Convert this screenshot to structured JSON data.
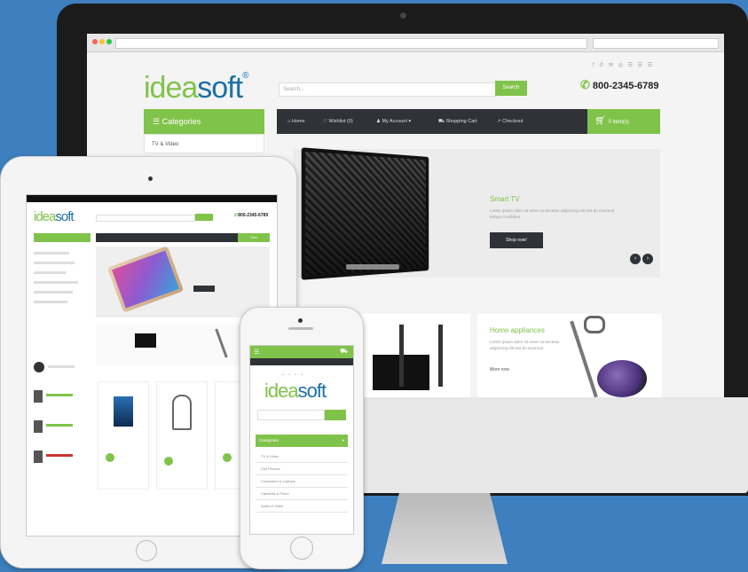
{
  "brand": {
    "idea": "idea",
    "soft": "soft",
    "reg": "®"
  },
  "desktop": {
    "search_placeholder": "Search...",
    "search_button": "Search",
    "phone": "800-2345-6789",
    "social": "f ✆ ✉ ◎  ☰ ☰ ☰",
    "categories_title": "Categories",
    "category_first": "TV & Video",
    "nav": [
      "Home",
      "Wishlist (0)",
      "My Account ▾",
      "Shopping Cart",
      "Checkout"
    ],
    "cart": "0 item(s)",
    "hero": {
      "title": "Smart TV",
      "text": "Lorem ipsum dolor sit amet consectetur adipiscing elit sed do eiusmod tempor incididunt",
      "button": "Shop now!"
    },
    "promo": {
      "title": "Home appliances",
      "text": "Lorem ipsum dolor sit amet consectetur adipiscing elit sed do eiusmod",
      "more": "More now"
    }
  },
  "tablet": {
    "cart_btn": "Cart",
    "phone": "800-2345-6789"
  },
  "mobile": {
    "categories_title": "Categories",
    "items": [
      "TV & Video",
      "Cell Phones",
      "Computers & Laptops",
      "Cameras & Photo",
      "Audio & Video"
    ]
  },
  "colors": {
    "accent": "#80c34a",
    "blue": "#1c6fa8",
    "dark": "#2f3236",
    "bg": "#3d7fbf"
  }
}
